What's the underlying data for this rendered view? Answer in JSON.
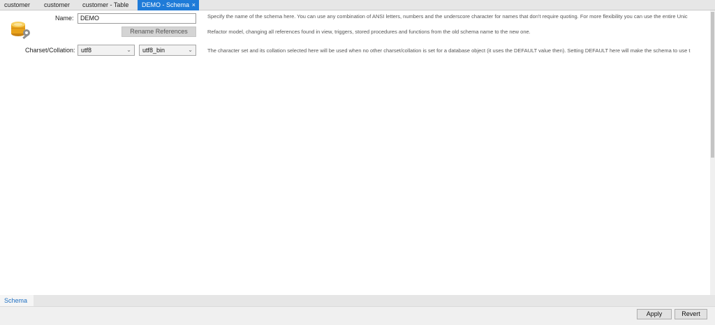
{
  "tabs": [
    {
      "label": "customer"
    },
    {
      "label": "customer"
    },
    {
      "label": "customer - Table"
    },
    {
      "label": "DEMO - Schema",
      "active": true,
      "close": "×"
    }
  ],
  "form": {
    "name_label": "Name:",
    "name_value": "DEMO",
    "name_description": "Specify the name of the schema here. You can use any combination of ANSI letters, numbers and the underscore character for names that don't require quoting. For more flexibility you can use the entire Unic",
    "rename_button": "Rename References",
    "rename_description": "Refactor model, changing all references found in view, triggers, stored procedures and functions from the old schema name to the new one.",
    "charset_label": "Charset/Collation:",
    "charset_value": "utf8",
    "collation_value": "utf8_bin",
    "charset_description": "The character set and its collation selected here will be used when no other charset/collation is set for a database object (it uses the DEFAULT value then). Setting DEFAULT here will make the schema to use t"
  },
  "bottom_tabs": [
    {
      "label": "Schema"
    }
  ],
  "footer": {
    "apply_label": "Apply",
    "revert_label": "Revert"
  },
  "icons": {
    "schema": "database-wrench-icon",
    "dropdown": "chevron-down-icon"
  },
  "colors": {
    "active_tab": "#1f7bd8",
    "bottom_tab_text": "#1f6fc1",
    "db_icon": "#e8a21a"
  }
}
